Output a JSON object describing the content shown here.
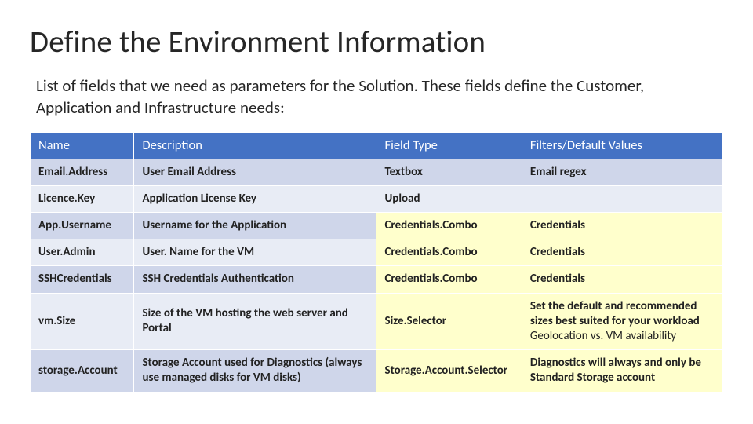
{
  "title": "Define the Environment Information",
  "intro": "List of fields that we need as parameters for the Solution. These fields define the Customer, Application and Infrastructure needs:",
  "table": {
    "headers": {
      "name": "Name",
      "description": "Description",
      "field_type": "Field Type",
      "filters": "Filters/Default Values"
    },
    "rows": [
      {
        "name": "Email.Address",
        "description": "User Email Address",
        "field_type": "Textbox",
        "filters": "Email regex"
      },
      {
        "name": "Licence.Key",
        "description": "Application License Key",
        "field_type": "Upload",
        "filters": ""
      },
      {
        "name": "App.Username",
        "description": "Username for the Application",
        "field_type": "Credentials.Combo",
        "filters": "Credentials"
      },
      {
        "name": "User.Admin",
        "description": "User. Name for the VM",
        "field_type": "Credentials.Combo",
        "filters": "Credentials"
      },
      {
        "name": "SSHCredentials",
        "description": "SSH Credentials Authentication",
        "field_type": "Credentials.Combo",
        "filters": "Credentials"
      },
      {
        "name": "vm.Size",
        "description": "Size of the VM hosting the web server and Portal",
        "field_type": "Size.Selector",
        "filters_line_a": "Set the default and recommended sizes best suited for your workload",
        "filters_line_b": "Geolocation vs. VM availability"
      },
      {
        "name": "storage.Account",
        "description": "Storage Account used for Diagnostics (always use managed disks for VM disks)",
        "field_type": "Storage.Account.Selector",
        "filters": "Diagnostics will always and only be Standard Storage account"
      }
    ]
  }
}
